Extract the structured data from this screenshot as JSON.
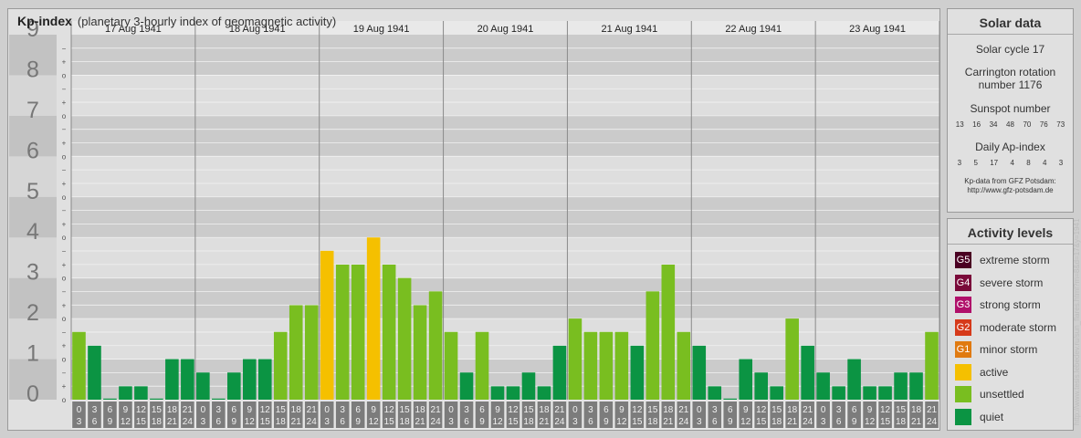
{
  "header": {
    "title": "Kp-index",
    "subtitle": "(planetary 3-hourly index of geomagnetic activity)"
  },
  "chart_data": {
    "type": "bar",
    "title": "Kp-index",
    "subtitle": "(planetary 3-hourly index of geomagnetic activity)",
    "ylim": [
      0,
      9
    ],
    "y_major_ticks": [
      "0",
      "1",
      "2",
      "3",
      "4",
      "5",
      "6",
      "7",
      "8",
      "9"
    ],
    "y_minor_ticks": [
      "o",
      "+",
      "−"
    ],
    "days": [
      "17 Aug 1941",
      "18 Aug 1941",
      "19 Aug 1941",
      "20 Aug 1941",
      "21 Aug 1941",
      "22 Aug 1941",
      "23 Aug 1941"
    ],
    "intervals": [
      [
        "0",
        "3"
      ],
      [
        "3",
        "6"
      ],
      [
        "6",
        "9"
      ],
      [
        "9",
        "12"
      ],
      [
        "12",
        "15"
      ],
      [
        "15",
        "18"
      ],
      [
        "18",
        "21"
      ],
      [
        "21",
        "24"
      ]
    ],
    "values": [
      1.67,
      1.33,
      0.0,
      0.33,
      0.33,
      0.0,
      1.0,
      1.0,
      0.67,
      0.0,
      0.67,
      1.0,
      1.0,
      1.67,
      2.33,
      2.33,
      3.67,
      3.33,
      3.33,
      4.0,
      3.33,
      3.0,
      2.33,
      2.67,
      1.67,
      0.67,
      1.67,
      0.33,
      0.33,
      0.67,
      0.33,
      1.33,
      2.0,
      1.67,
      1.67,
      1.67,
      1.33,
      2.67,
      3.33,
      1.67,
      1.33,
      0.33,
      0.0,
      1.0,
      0.67,
      0.33,
      2.0,
      1.33,
      0.67,
      0.33,
      1.0,
      0.33,
      0.33,
      0.67,
      0.67,
      1.67
    ]
  },
  "solar": {
    "title": "Solar data",
    "cycle": "Solar cycle 17",
    "carrington_1": "Carrington rotation",
    "carrington_2": "number 1176",
    "sunspot_title": "Sunspot number",
    "sunspots": [
      "13",
      "16",
      "34",
      "48",
      "70",
      "76",
      "73"
    ],
    "ap_title": "Daily Ap-index",
    "ap": [
      "3",
      "5",
      "17",
      "4",
      "8",
      "4",
      "3"
    ],
    "credit_1": "Kp-data from GFZ Potsdam:",
    "credit_2": "http://www.gfz-potsdam.de"
  },
  "activity": {
    "title": "Activity levels",
    "levels": [
      {
        "badge": "G5",
        "label": "extreme storm",
        "color": "#4a0022"
      },
      {
        "badge": "G4",
        "label": "severe storm",
        "color": "#7a0a3a"
      },
      {
        "badge": "G3",
        "label": "strong storm",
        "color": "#b0106a"
      },
      {
        "badge": "G2",
        "label": "moderate storm",
        "color": "#d63a1a"
      },
      {
        "badge": "G1",
        "label": "minor storm",
        "color": "#e07a10"
      },
      {
        "badge": "",
        "label": "active",
        "color": "#f5c000"
      },
      {
        "badge": "",
        "label": "unsettled",
        "color": "#79be20"
      },
      {
        "badge": "",
        "label": "quiet",
        "color": "#0b9443"
      }
    ]
  },
  "side_url": "http://www.tesis.lebedev.ru/sun_flares.html?m=8&d=17&y=1941",
  "colors": {
    "quiet": "#0b9443",
    "unsettled": "#79be20",
    "active": "#f5c000",
    "band_dark": "#cbcbcb",
    "band_light": "#dedede"
  }
}
